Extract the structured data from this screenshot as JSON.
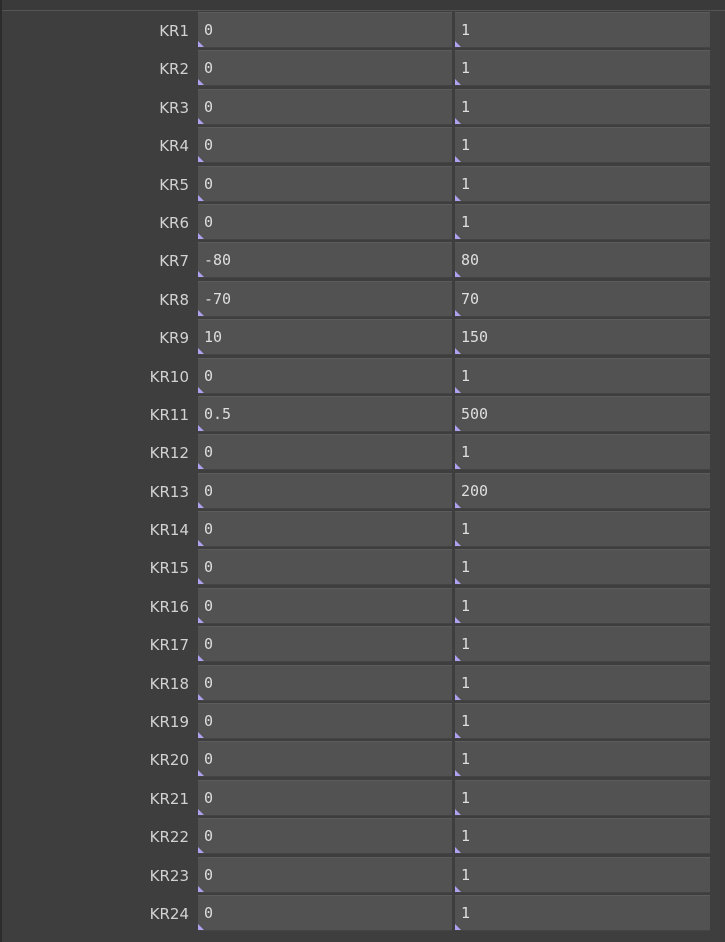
{
  "params": [
    {
      "label": "KR1",
      "min": "0",
      "max": "1"
    },
    {
      "label": "KR2",
      "min": "0",
      "max": "1"
    },
    {
      "label": "KR3",
      "min": "0",
      "max": "1"
    },
    {
      "label": "KR4",
      "min": "0",
      "max": "1"
    },
    {
      "label": "KR5",
      "min": "0",
      "max": "1"
    },
    {
      "label": "KR6",
      "min": "0",
      "max": "1"
    },
    {
      "label": "KR7",
      "min": "-80",
      "max": "80"
    },
    {
      "label": "KR8",
      "min": "-70",
      "max": "70"
    },
    {
      "label": "KR9",
      "min": "10",
      "max": "150"
    },
    {
      "label": "KR10",
      "min": "0",
      "max": "1"
    },
    {
      "label": "KR11",
      "min": "0.5",
      "max": "500"
    },
    {
      "label": "KR12",
      "min": "0",
      "max": "1"
    },
    {
      "label": "KR13",
      "min": "0",
      "max": "200"
    },
    {
      "label": "KR14",
      "min": "0",
      "max": "1"
    },
    {
      "label": "KR15",
      "min": "0",
      "max": "1"
    },
    {
      "label": "KR16",
      "min": "0",
      "max": "1"
    },
    {
      "label": "KR17",
      "min": "0",
      "max": "1"
    },
    {
      "label": "KR18",
      "min": "0",
      "max": "1"
    },
    {
      "label": "KR19",
      "min": "0",
      "max": "1"
    },
    {
      "label": "KR20",
      "min": "0",
      "max": "1"
    },
    {
      "label": "KR21",
      "min": "0",
      "max": "1"
    },
    {
      "label": "KR22",
      "min": "0",
      "max": "1"
    },
    {
      "label": "KR23",
      "min": "0",
      "max": "1"
    },
    {
      "label": "KR24",
      "min": "0",
      "max": "1"
    }
  ],
  "icons": {
    "field_corner": "expression-marker-icon"
  },
  "colors": {
    "field_bg": "#525252",
    "panel_bg": "#3e3e3e",
    "label_text": "#d2d2d2",
    "marker": "#b0a0f0"
  }
}
